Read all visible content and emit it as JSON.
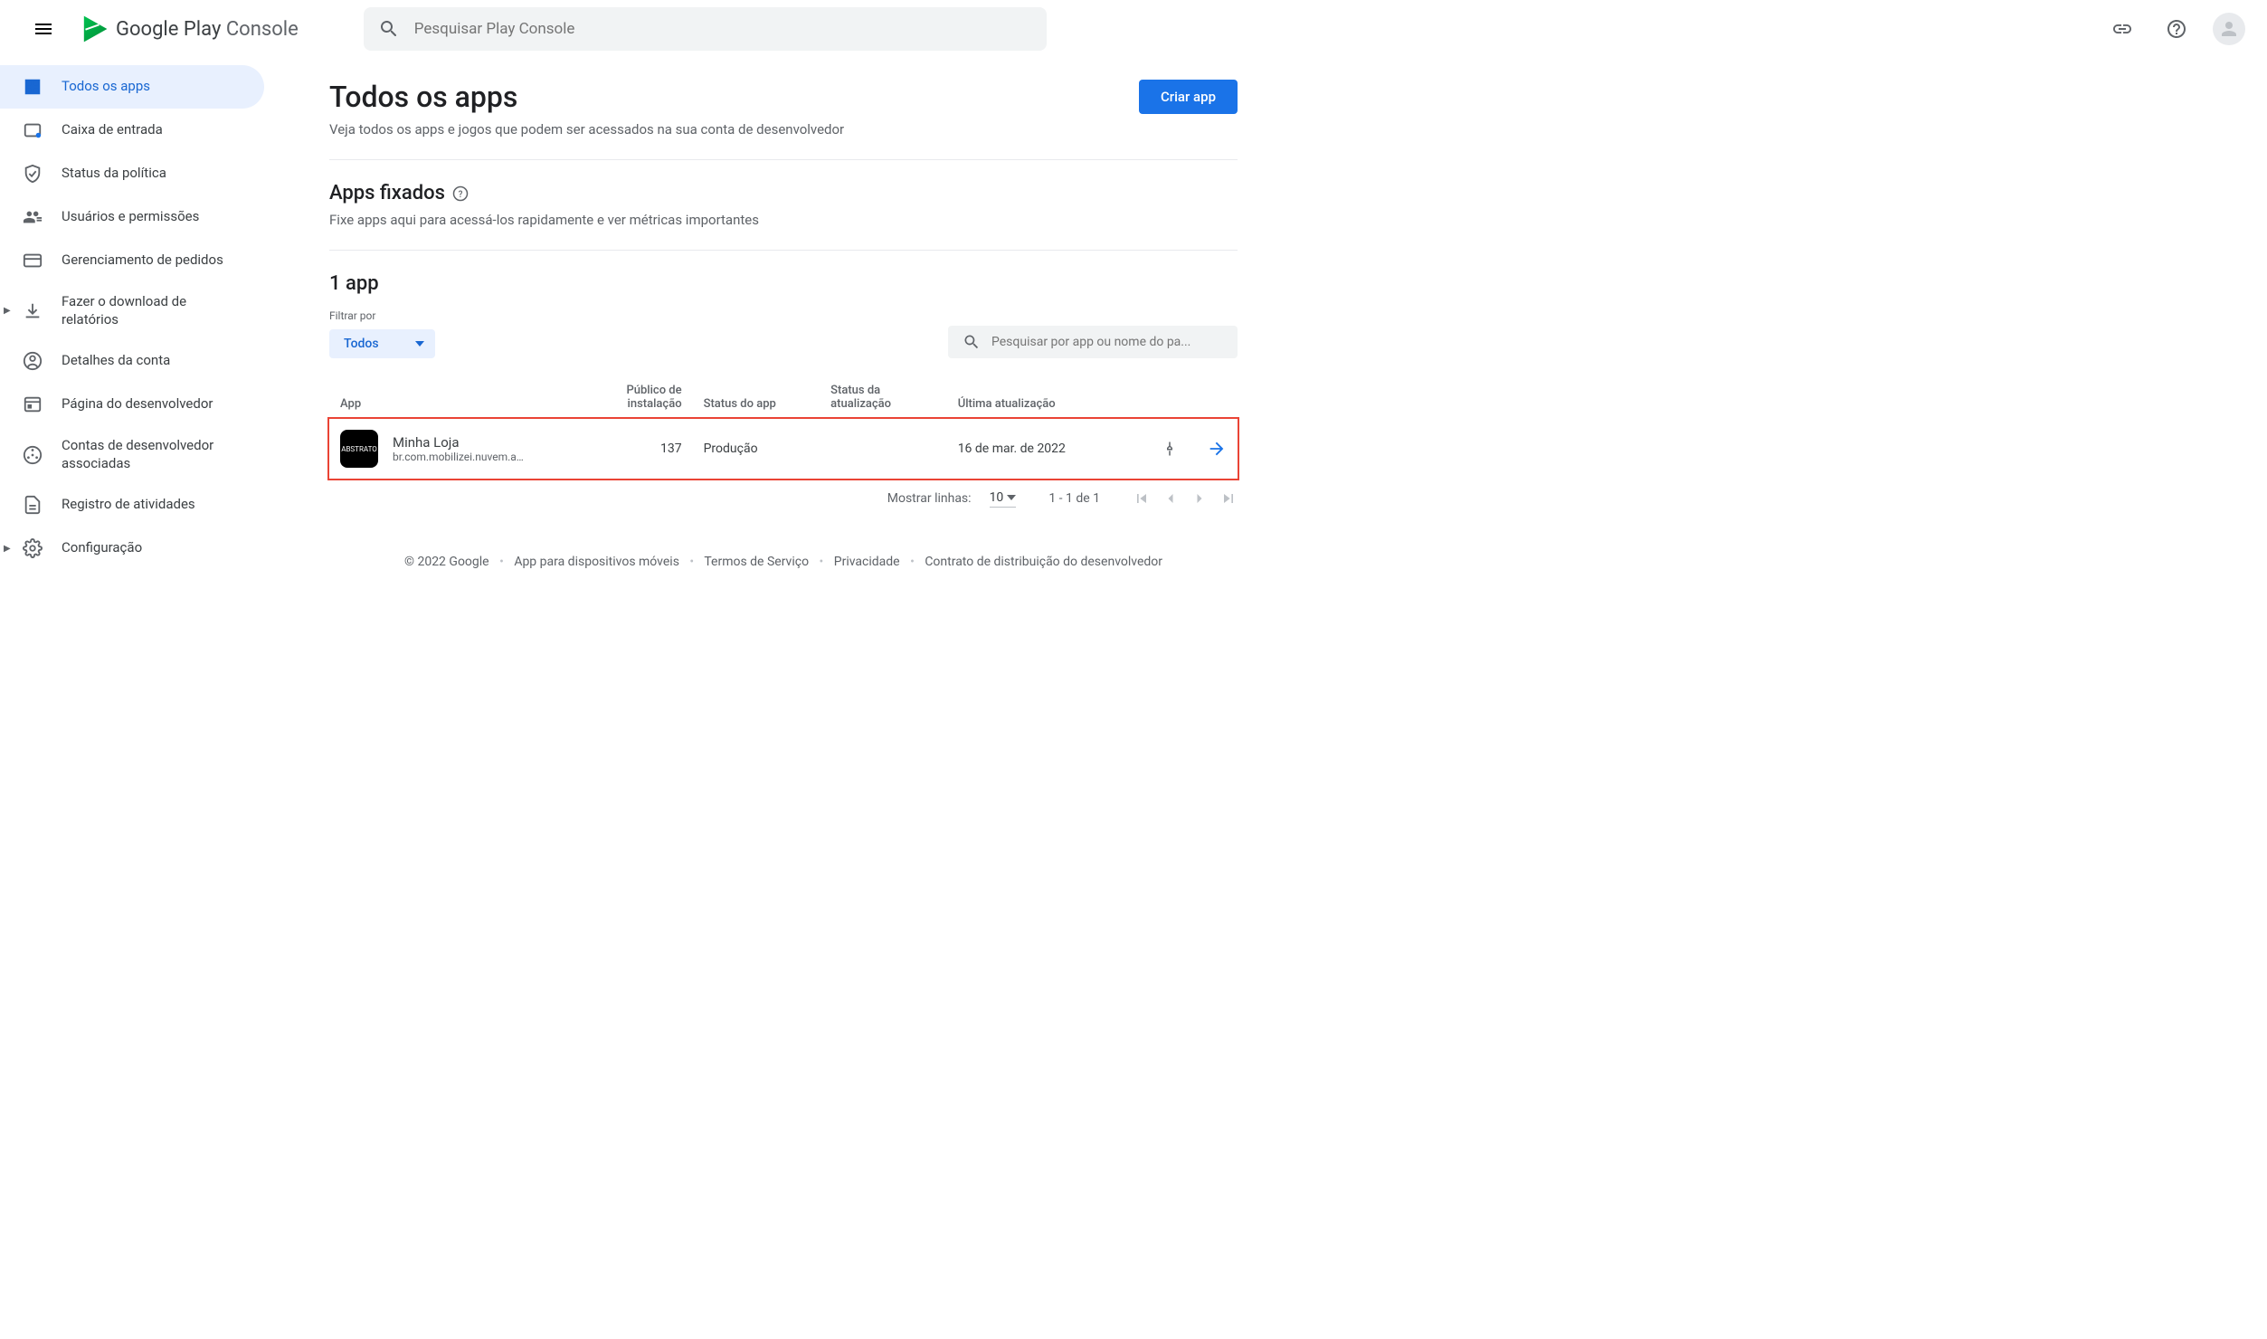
{
  "header": {
    "logo_google": "Google",
    "logo_play": "Play",
    "logo_console": "Console",
    "search_placeholder": "Pesquisar Play Console"
  },
  "sidebar": {
    "items": [
      {
        "label": "Todos os apps",
        "active": true
      },
      {
        "label": "Caixa de entrada"
      },
      {
        "label": "Status da política"
      },
      {
        "label": "Usuários e permissões"
      },
      {
        "label": "Gerenciamento de pedidos"
      },
      {
        "label": "Fazer o download de relatórios",
        "expandable": true
      },
      {
        "label": "Detalhes da conta"
      },
      {
        "label": "Página do desenvolvedor"
      },
      {
        "label": "Contas de desenvolvedor associadas"
      },
      {
        "label": "Registro de atividades"
      },
      {
        "label": "Configuração",
        "expandable": true
      }
    ]
  },
  "main": {
    "title": "Todos os apps",
    "subtitle": "Veja todos os apps e jogos que podem ser acessados na sua conta de desenvolvedor",
    "create_button": "Criar app",
    "pinned": {
      "title": "Apps fixados",
      "desc": "Fixe apps aqui para acessá-los rapidamente e ver métricas importantes"
    },
    "apps": {
      "count_title": "1 app",
      "filter_label": "Filtrar por",
      "filter_value": "Todos",
      "search_placeholder": "Pesquisar por app ou nome do pa...",
      "columns": {
        "app": "App",
        "installs": "Público de instalação",
        "app_status": "Status do app",
        "update_status": "Status da atualização",
        "last_update": "Última atualização"
      },
      "rows": [
        {
          "name": "Minha Loja",
          "package": "br.com.mobilizei.nuvem.a…",
          "installs": "137",
          "app_status": "Produção",
          "update_status": "",
          "last_update": "16 de mar. de 2022"
        }
      ],
      "pagination": {
        "show_rows_label": "Mostrar linhas:",
        "rows_per_page": "10",
        "range": "1 - 1 de 1"
      }
    }
  },
  "footer": {
    "copyright": "© 2022 Google",
    "links": [
      "App para dispositivos móveis",
      "Termos de Serviço",
      "Privacidade",
      "Contrato de distribuição do desenvolvedor"
    ]
  }
}
